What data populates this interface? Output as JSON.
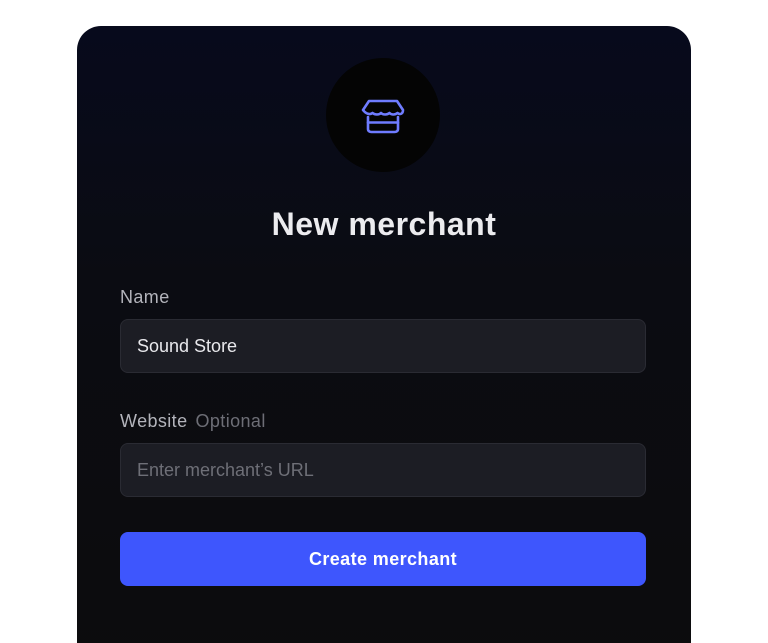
{
  "form": {
    "icon": "storefront-icon",
    "title": "New merchant",
    "name_label": "Name",
    "name_value": "Sound Store",
    "website_label": "Website",
    "website_optional": "Optional",
    "website_placeholder": "Enter merchant’s URL",
    "submit_label": "Create merchant"
  },
  "colors": {
    "accent": "#3e56fd",
    "icon": "#6f7cff",
    "card_bg": "#0c0c0d",
    "input_bg": "#1c1d24"
  }
}
